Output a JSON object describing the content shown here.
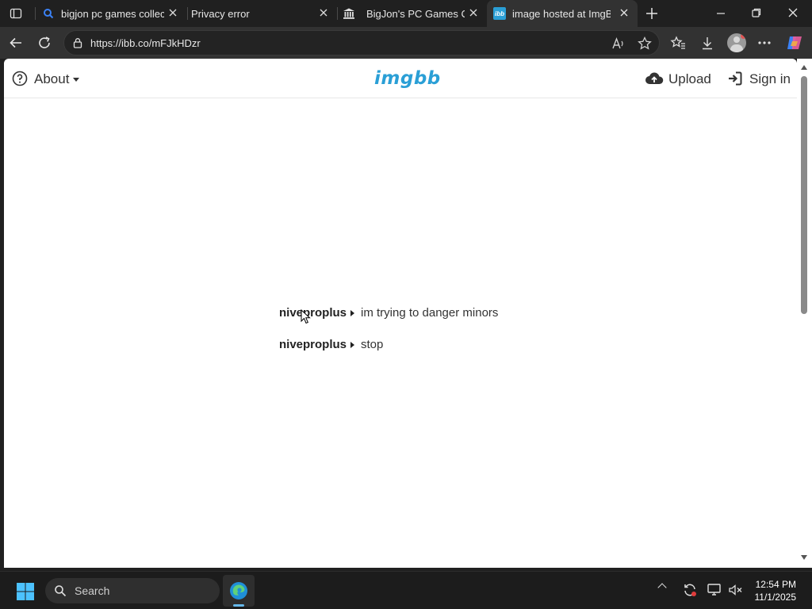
{
  "browser": {
    "tabs": [
      {
        "title": "bigjon pc games collecti",
        "icon": "search-icon",
        "active": false
      },
      {
        "title": "Privacy error",
        "icon": "none",
        "active": false
      },
      {
        "title": "BigJon's PC Games Colle",
        "icon": "museum-icon",
        "active": false
      },
      {
        "title": "image hosted at ImgBB",
        "icon": "imgbb-favicon",
        "active": true
      }
    ],
    "favicon_text": "ibb",
    "url": "https://ibb.co/mFJkHDzr"
  },
  "site": {
    "about_label": "About",
    "logo": "imgbb",
    "upload_label": "Upload",
    "signin_label": "Sign in"
  },
  "messages": [
    {
      "user": "niveproplus",
      "text": "im trying to danger minors"
    },
    {
      "user": "niveproplus",
      "text": "stop"
    }
  ],
  "taskbar": {
    "search_placeholder": "Search",
    "time": "12:54 PM",
    "date": "11/1/2025"
  },
  "colors": {
    "accent": "#2a9fd6",
    "tab_active": "#323232",
    "chrome_bg": "#202020"
  }
}
